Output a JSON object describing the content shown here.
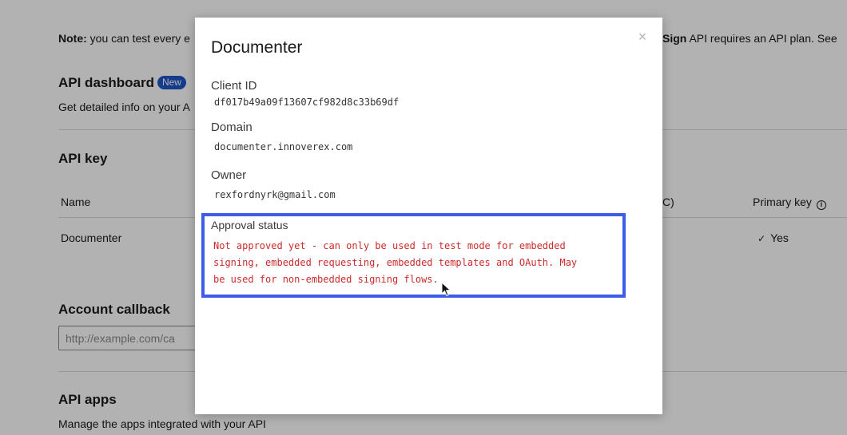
{
  "background": {
    "note_bold": "Note:",
    "note_text": " you can test every e",
    "note_right_bold": "Sign",
    "note_right_text": " API requires an API plan. See",
    "api_dashboard": {
      "title": "API dashboard",
      "badge": "New",
      "description": "Get detailed info on your A"
    },
    "api_key": {
      "title": "API key",
      "columns": {
        "name": "Name",
        "partial": "C)",
        "primary_key": "Primary key"
      },
      "row": {
        "name": "Documenter",
        "primary_key": "Yes"
      }
    },
    "account_callback": {
      "title": "Account callback",
      "placeholder": "http://example.com/ca"
    },
    "api_apps": {
      "title": "API apps",
      "description": "Manage the apps integrated with your API"
    }
  },
  "modal": {
    "title": "Documenter",
    "close_label": "×",
    "fields": [
      {
        "label": "Client ID",
        "value": "df017b49a09f13607cf982d8c33b69df"
      },
      {
        "label": "Domain",
        "value": "documenter.innoverex.com"
      },
      {
        "label": "Owner",
        "value": "rexfordnyrk@gmail.com"
      }
    ],
    "approval": {
      "label": "Approval status",
      "line1": "Not approved yet - can only be used in test mode for embedded",
      "line2": "signing, embedded requesting, embedded templates and OAuth. May",
      "line3": "be used for non-embedded signing flows."
    }
  },
  "colors": {
    "badge": "#1f56c9",
    "highlight_border": "#3f5ce8",
    "status_text": "#cc2b2b"
  }
}
